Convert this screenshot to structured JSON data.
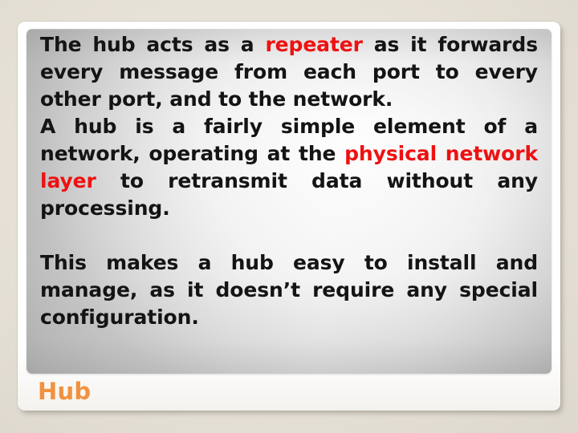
{
  "slide": {
    "title": "Hub",
    "background_color": "#e5e0d6",
    "card_color": "#ffffff",
    "title_color": "#f2913e",
    "highlight_color": "#ee1111",
    "body_text_color": "#141414"
  },
  "content": {
    "paragraph1": {
      "seg1": "The hub acts as a ",
      "seg2_highlight": "repeater",
      "seg3": " as it forwards every message from each port to every other port, and to the network."
    },
    "paragraph2": {
      "seg1": "A hub is a fairly simple element of a network, operating at the ",
      "seg2_highlight": "physical network layer",
      "seg3": " to retransmit data without any processing."
    },
    "paragraph3": {
      "seg1": "This makes a hub easy to install and manage, as it doesn’t require any special configuration."
    }
  }
}
